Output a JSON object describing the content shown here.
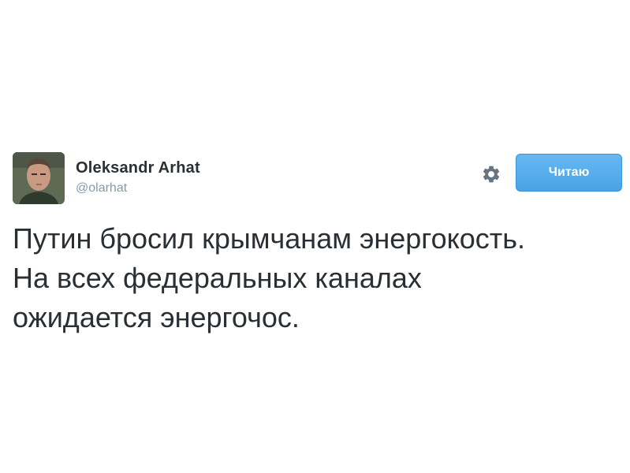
{
  "tweet": {
    "author": {
      "display_name": "Oleksandr Arhat",
      "handle": "@olarhat"
    },
    "follow_button_label": "Читаю",
    "text_lines": [
      "Путин бросил крымчанам энергокость.",
      "На всех федеральных каналах",
      "ожидается энергочос."
    ]
  },
  "icons": {
    "settings": "gear-icon",
    "avatar": "avatar"
  },
  "colors": {
    "follow_button": "#55acee",
    "name_text": "#292f33",
    "handle_text": "#8899a6",
    "gear": "#66757f"
  }
}
